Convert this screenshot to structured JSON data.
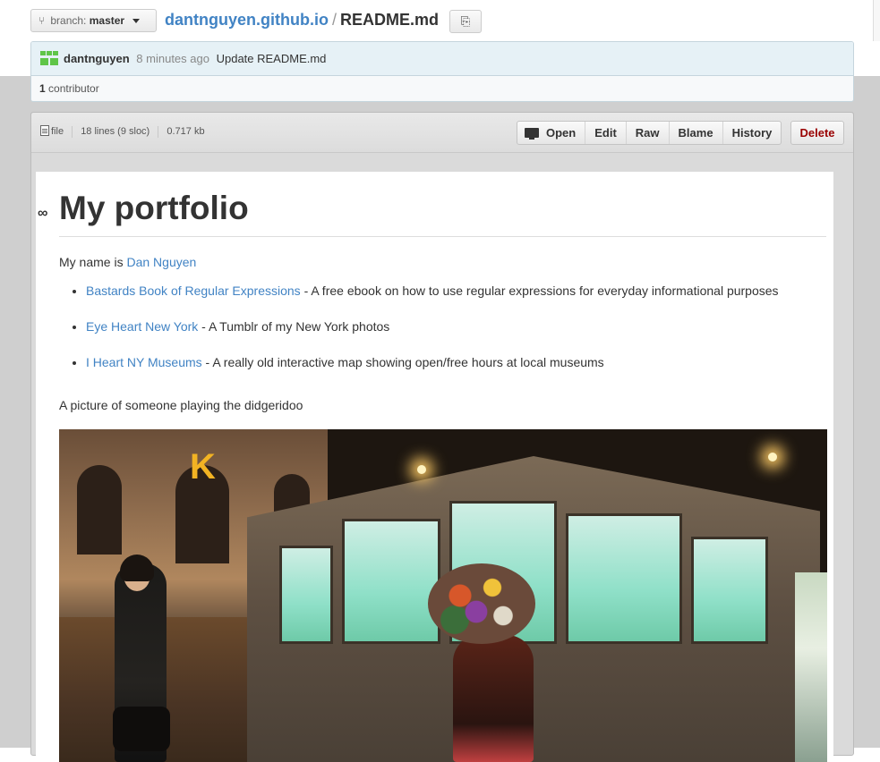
{
  "breadcrumb": {
    "branch_prefix": "branch:",
    "branch_name": "master",
    "repo": "dantnguyen.github.io",
    "separator": "/",
    "file_name": "README.md"
  },
  "commit": {
    "author": "dantnguyen",
    "time_ago": "8 minutes ago",
    "message": "Update README.md",
    "contributor_count": "1",
    "contributor_label": "contributor"
  },
  "file_header": {
    "type_label": "file",
    "lines": "18 lines (9 sloc)",
    "size": "0.717 kb",
    "buttons": [
      "Open",
      "Edit",
      "Raw",
      "Blame",
      "History"
    ],
    "delete_label": "Delete"
  },
  "readme": {
    "heading": "My portfolio",
    "intro_prefix": "My name is",
    "intro_link": "Dan Nguyen",
    "items": [
      {
        "link": "Bastards Book of Regular Expressions",
        "text": " - A free ebook on how to use regular expressions for everyday informational purposes"
      },
      {
        "link": "Eye Heart New York",
        "text": " - A Tumblr of my New York photos"
      },
      {
        "link": "I Heart NY Museums",
        "text": " - A really old interactive map showing open/free hours at local museums"
      }
    ],
    "picture_caption": "A picture of someone playing the didgeridoo"
  },
  "photo": {
    "sign_letter": "K"
  },
  "colors": {
    "link": "#4183c4",
    "commit_bg": "#e6f1f6",
    "delete_text": "#990000",
    "avatar_green": "#5fc548"
  }
}
